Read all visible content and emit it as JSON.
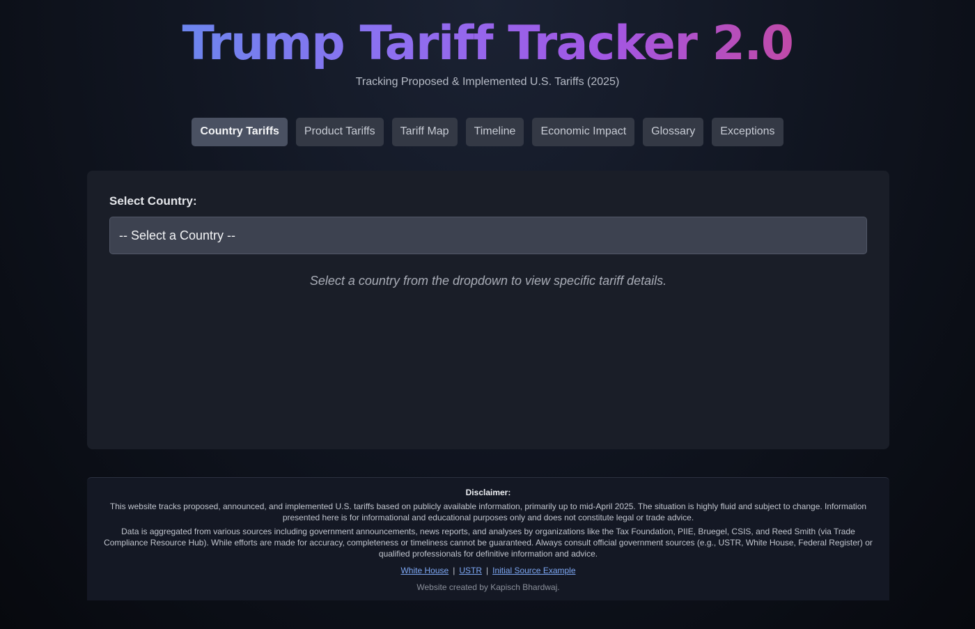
{
  "header": {
    "title": "Trump Tariff Tracker 2.0",
    "subtitle": "Tracking Proposed & Implemented U.S. Tariffs (2025)"
  },
  "tabs": [
    {
      "label": "Country Tariffs",
      "active": true
    },
    {
      "label": "Product Tariffs",
      "active": false
    },
    {
      "label": "Tariff Map",
      "active": false
    },
    {
      "label": "Timeline",
      "active": false
    },
    {
      "label": "Economic Impact",
      "active": false
    },
    {
      "label": "Glossary",
      "active": false
    },
    {
      "label": "Exceptions",
      "active": false
    }
  ],
  "main": {
    "select_label": "Select Country:",
    "select_value": "-- Select a Country --",
    "hint": "Select a country from the dropdown to view specific tariff details."
  },
  "footer": {
    "disclaimer_title": "Disclaimer:",
    "para1": "This website tracks proposed, announced, and implemented U.S. tariffs based on publicly available information, primarily up to mid-April 2025. The situation is highly fluid and subject to change. Information presented here is for informational and educational purposes only and does not constitute legal or trade advice.",
    "para2": "Data is aggregated from various sources including government announcements, news reports, and analyses by organizations like the Tax Foundation, PIIE, Bruegel, CSIS, and Reed Smith (via Trade Compliance Resource Hub). While efforts are made for accuracy, completeness or timeliness cannot be guaranteed. Always consult official government sources (e.g., USTR, White House, Federal Register) or qualified professionals for definitive information and advice.",
    "links": [
      "White House",
      "USTR",
      "Initial Source Example"
    ],
    "separator": "|",
    "credit": "Website created by Kapisch Bhardwaj."
  },
  "colors": {
    "title_gradient": [
      "#6c85ee",
      "#8e6ff0",
      "#a357e3",
      "#c04aa8"
    ],
    "link": "#7ea8f5",
    "panel_bg": "#1a1e28",
    "tab_bg": "#343945",
    "tab_active_bg": "#4a5162"
  }
}
